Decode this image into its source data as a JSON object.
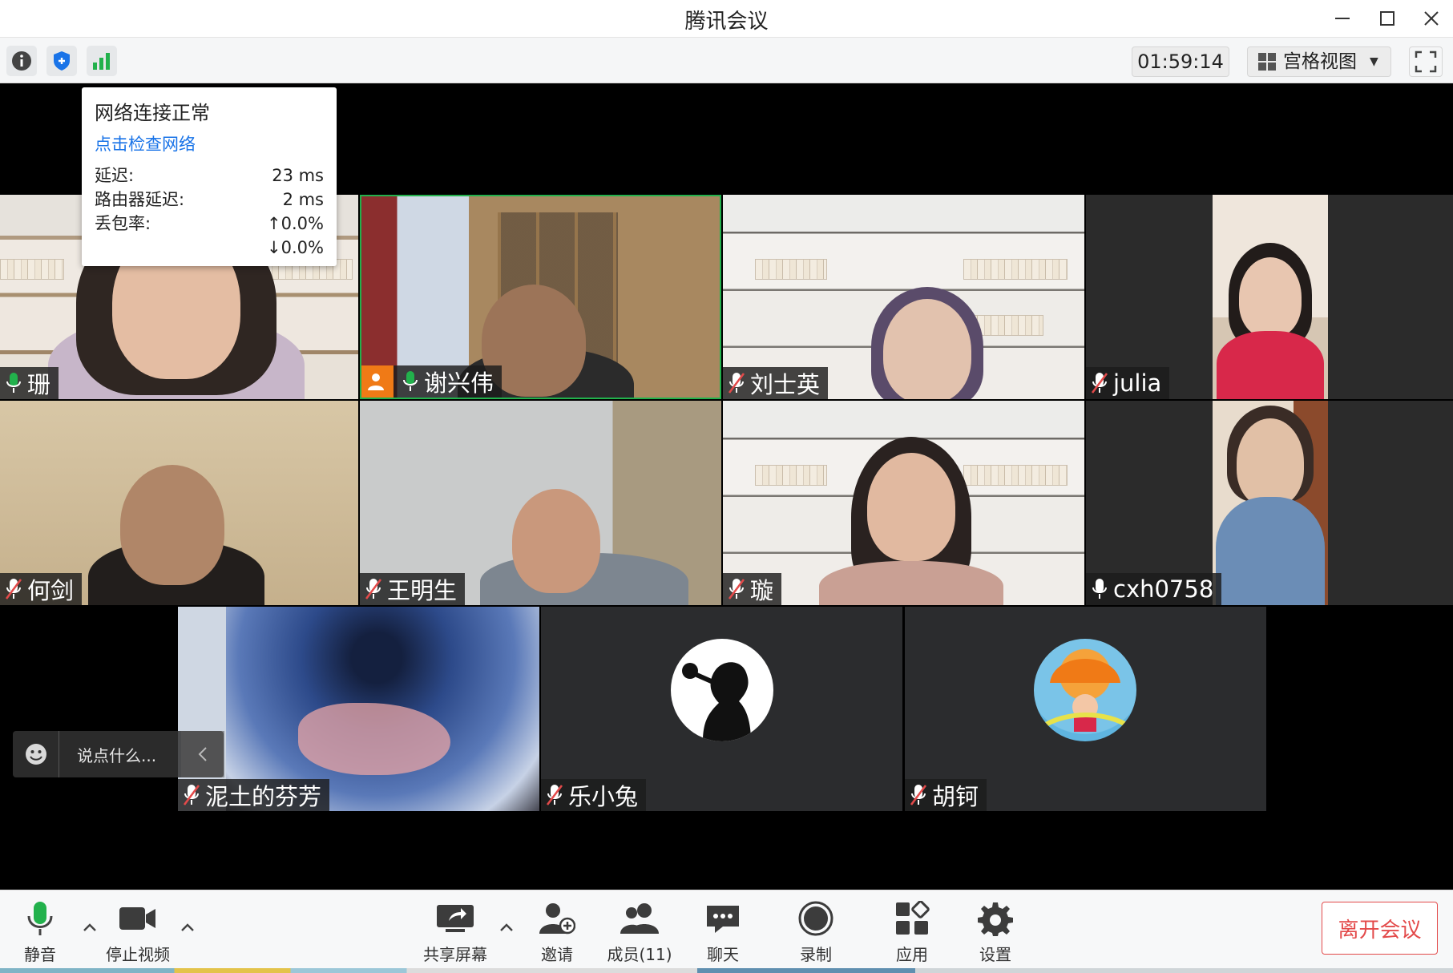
{
  "window": {
    "title": "腾讯会议"
  },
  "toolbar": {
    "info_icon": "info-icon",
    "shield_icon": "shield-icon",
    "signal_icon": "signal-bars-icon",
    "timer": "01:59:14",
    "view_mode": "宫格视图"
  },
  "network_popup": {
    "title": "网络连接正常",
    "link": "点击检查网络",
    "latency_label": "延迟:",
    "latency_value": "23 ms",
    "router_label": "路由器延迟:",
    "router_value": "2 ms",
    "loss_label": "丢包率:",
    "loss_up": "↑0.0%",
    "loss_down": "↓0.0%"
  },
  "participants": [
    {
      "name": "珊",
      "mic": "on"
    },
    {
      "name": "谢兴伟",
      "mic": "on",
      "host": true,
      "speaking": true
    },
    {
      "name": "刘士英",
      "mic": "muted"
    },
    {
      "name": "julia",
      "mic": "muted"
    },
    {
      "name": "何剑",
      "mic": "muted"
    },
    {
      "name": "王明生",
      "mic": "muted"
    },
    {
      "name": "璇",
      "mic": "muted"
    },
    {
      "name": "cxh0758",
      "mic": "on"
    },
    {
      "name": "泥土的芬芳",
      "mic": "muted"
    },
    {
      "name": "乐小兔",
      "mic": "muted"
    },
    {
      "name": "胡钶",
      "mic": "muted"
    }
  ],
  "chat": {
    "placeholder": "说点什么..."
  },
  "controls": {
    "mute": "静音",
    "stop_video": "停止视频",
    "share_screen": "共享屏幕",
    "invite": "邀请",
    "members": "成员(11)",
    "chat": "聊天",
    "record": "录制",
    "apps": "应用",
    "settings": "设置",
    "leave": "离开会议"
  },
  "colors": {
    "accent_green": "#22b14c",
    "link_blue": "#1a74e8",
    "leave_red": "#e34a4a",
    "host_orange": "#f07a16"
  }
}
